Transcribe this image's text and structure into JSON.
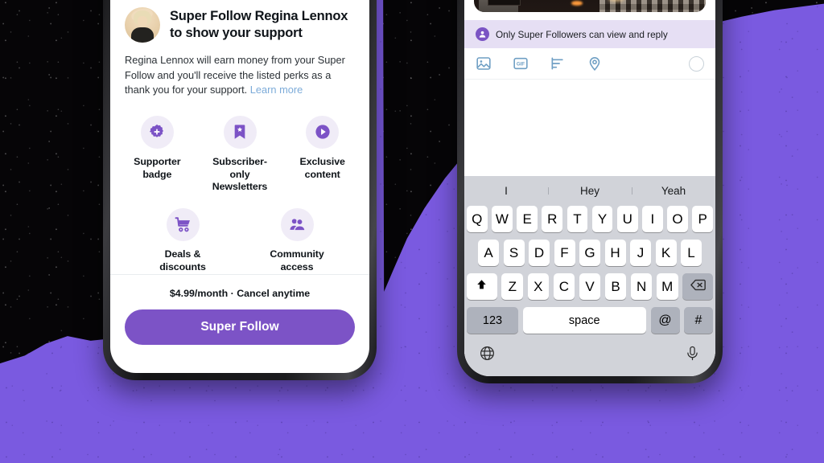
{
  "background": {
    "top_color": "#060507",
    "bottom_color": "#7a5ae0"
  },
  "left_phone": {
    "sheet": {
      "avatar_alt": "Regina Lennox profile photo",
      "title": "Super Follow Regina Lennox to show your support",
      "description": "Regina Lennox will earn money from your Super Follow and you'll receive the listed perks as a thank you for your support.",
      "learn_more": "Learn more",
      "perks": [
        {
          "icon": "supporter-badge-icon",
          "label": "Supporter badge"
        },
        {
          "icon": "bookmark-newsletter-icon",
          "label": "Subscriber-only Newsletters"
        },
        {
          "icon": "play-exclusive-icon",
          "label": "Exclusive content"
        },
        {
          "icon": "shopping-cart-icon",
          "label": "Deals & discounts"
        },
        {
          "icon": "community-people-icon",
          "label": "Community access"
        }
      ],
      "price_line": "$4.99/month · Cancel anytime",
      "cta_label": "Super Follow",
      "accent_color": "#7c53c6",
      "icon_bg_color": "#f0ecf7"
    }
  },
  "right_phone": {
    "compose": {
      "media_alt": "Video thumbnail of a city street under an elevated structure",
      "play_icon": "play-icon",
      "play_color": "#1d9bf0",
      "notice_icon": "super-follower-icon",
      "notice_text": "Only Super Followers can view and reply",
      "notice_bg": "#e6dff4",
      "toolbar": [
        {
          "icon": "image-icon",
          "label": "Add photo"
        },
        {
          "icon": "gif-icon",
          "label": "GIF"
        },
        {
          "icon": "poll-icon",
          "label": "Poll"
        },
        {
          "icon": "location-icon",
          "label": "Location"
        }
      ],
      "character_counter": "character-counter-ring"
    },
    "keyboard": {
      "suggestions": [
        "I",
        "Hey",
        "Yeah"
      ],
      "row1": [
        "Q",
        "W",
        "E",
        "R",
        "T",
        "Y",
        "U",
        "I",
        "O",
        "P"
      ],
      "row2": [
        "A",
        "S",
        "D",
        "F",
        "G",
        "H",
        "J",
        "K",
        "L"
      ],
      "row3": [
        "Z",
        "X",
        "C",
        "V",
        "B",
        "N",
        "M"
      ],
      "shift_icon": "shift-arrow-icon",
      "backspace_icon": "backspace-icon",
      "numbers_key": "123",
      "space_key": "space",
      "at_key": "@",
      "hash_key": "#",
      "globe_icon": "globe-icon",
      "mic_icon": "microphone-icon"
    }
  }
}
